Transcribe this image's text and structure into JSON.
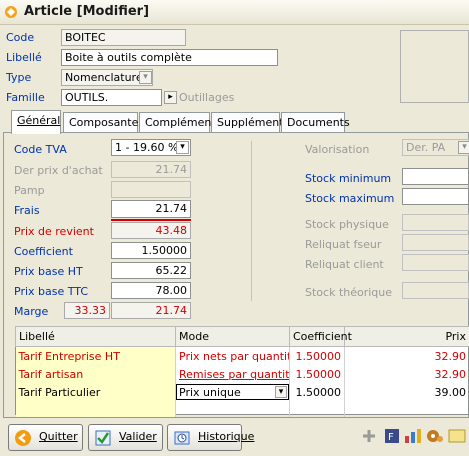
{
  "window": {
    "title": "Article [Modifier]"
  },
  "header": {
    "code_label": "Code",
    "code_value": "BOITEC",
    "libelle_label": "Libellé",
    "libelle_value": "Boite à outils complète",
    "type_label": "Type",
    "type_value": "Nomenclature",
    "famille_label": "Famille",
    "famille_value": "OUTILS.",
    "famille_desc": "Outillages"
  },
  "tabs": [
    {
      "label": "Général"
    },
    {
      "label": "Composantes"
    },
    {
      "label": "Compléments"
    },
    {
      "label": "Supplément"
    },
    {
      "label": "Documents"
    }
  ],
  "general": {
    "code_tva_label": "Code TVA",
    "code_tva_value": "1 - 19.60 %",
    "der_prix_achat_label": "Der prix d'achat",
    "der_prix_achat_value": "21.74",
    "pamp_label": "Pamp",
    "pamp_value": "",
    "frais_label": "Frais",
    "frais_value": "21.74",
    "prix_revient_label": "Prix de revient",
    "prix_revient_value": "43.48",
    "coefficient_label": "Coefficient",
    "coefficient_value": "1.50000",
    "prix_base_ht_label": "Prix base HT",
    "prix_base_ht_value": "65.22",
    "prix_base_ttc_label": "Prix base TTC",
    "prix_base_ttc_value": "78.00",
    "marge_label": "Marge",
    "marge_pct": "33.33",
    "marge_value": "21.74"
  },
  "stock": {
    "valorisation_label": "Valorisation",
    "valorisation_value": "Der. PA",
    "stock_min_label": "Stock minimum",
    "stock_max_label": "Stock maximum",
    "stock_physique_label": "Stock physique",
    "reliquat_fseur_label": "Reliquat fseur",
    "reliquat_client_label": "Reliquat client",
    "stock_theorique_label": "Stock théorique"
  },
  "grid": {
    "columns": [
      "Libellé",
      "Mode",
      "Coefficient",
      "Prix"
    ],
    "rows": [
      {
        "libelle": "Tarif Entreprise  HT",
        "mode": "Prix nets par quantité",
        "coefficient": "1.50000",
        "prix": "32.90"
      },
      {
        "libelle": "Tarif artisan",
        "mode": "Remises par quantité",
        "coefficient": "1.50000",
        "prix": "32.90"
      },
      {
        "libelle": "Tarif Particulier",
        "mode": "Prix unique",
        "coefficient": "1.50000",
        "prix": "39.00"
      }
    ]
  },
  "buttons": {
    "quitter": "Quitter",
    "valider": "Valider",
    "historique": "Historique"
  },
  "colors": {
    "label_blue": "#0033aa",
    "red": "#d20000",
    "yellow_cell": "#ffffc8"
  }
}
